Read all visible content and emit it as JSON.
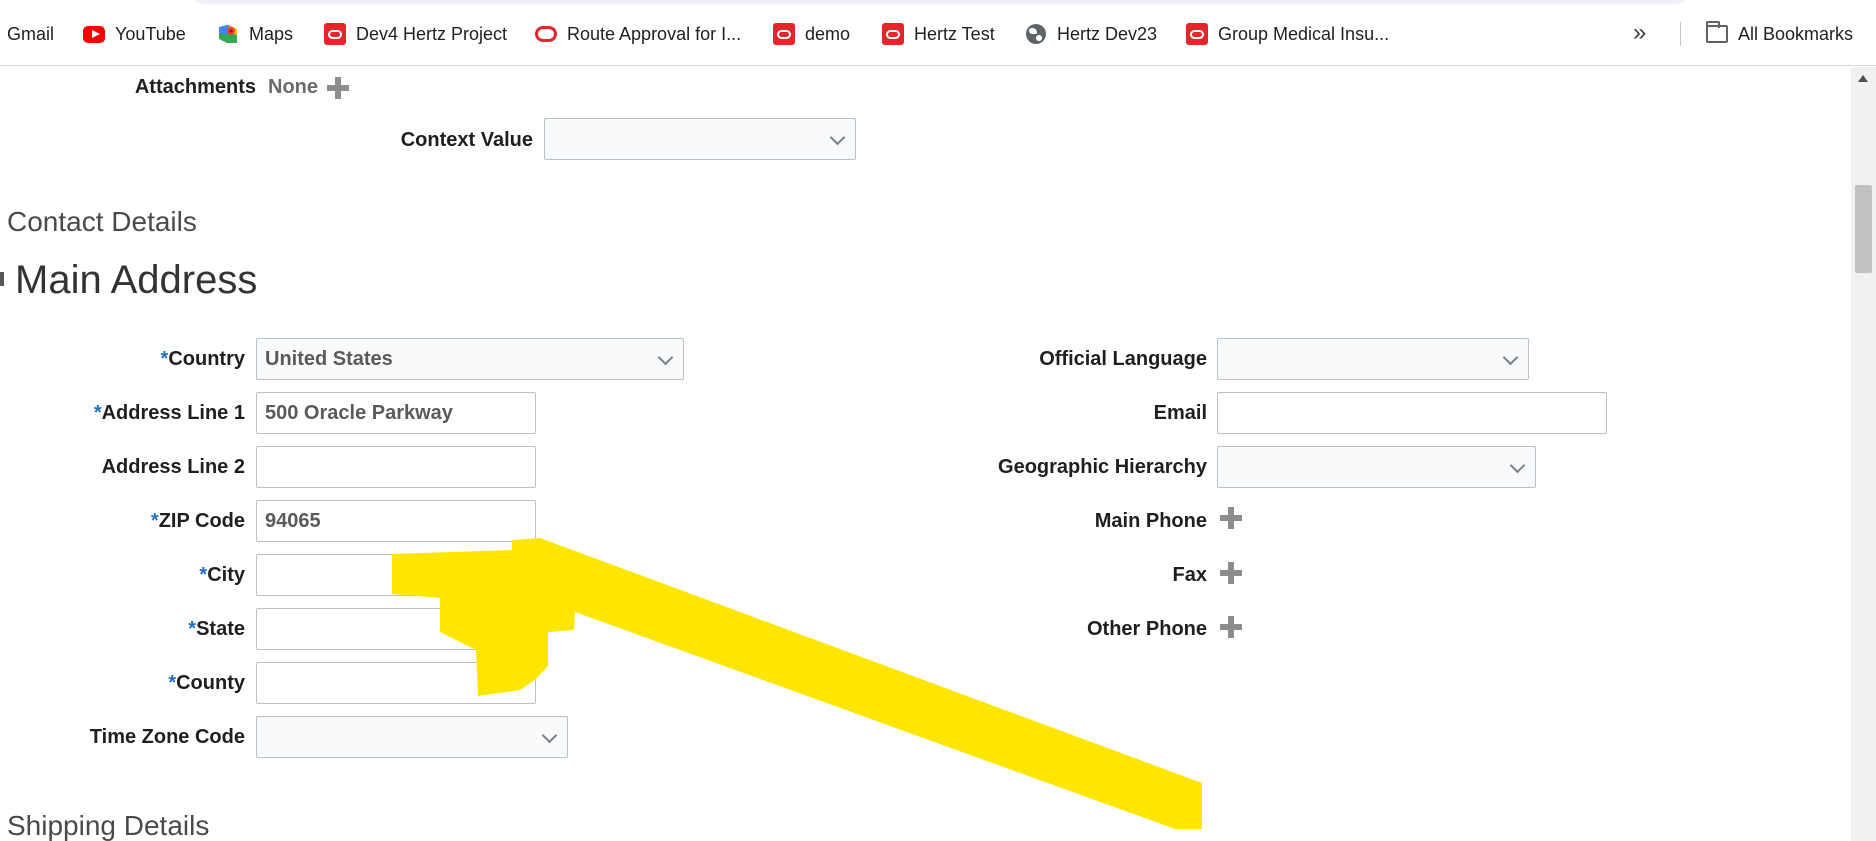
{
  "bookmarks": [
    {
      "label": "Gmail",
      "icon": "gmail-icon"
    },
    {
      "label": "YouTube",
      "icon": "youtube-icon"
    },
    {
      "label": "Maps",
      "icon": "maps-icon"
    },
    {
      "label": "Dev4 Hertz Project",
      "icon": "oracle-icon"
    },
    {
      "label": "Route Approval for I...",
      "icon": "oracle-outline-icon"
    },
    {
      "label": "demo",
      "icon": "oracle-icon"
    },
    {
      "label": "Hertz Test",
      "icon": "oracle-icon"
    },
    {
      "label": "Hertz Dev23",
      "icon": "globe-icon"
    },
    {
      "label": "Group Medical Insu...",
      "icon": "oracle-icon"
    }
  ],
  "more_bookmarks_glyph": "»",
  "all_bookmarks_label": "All Bookmarks",
  "attachments": {
    "label": "Attachments",
    "value": "None"
  },
  "context_value": {
    "label": "Context Value",
    "value": ""
  },
  "sections": {
    "contact_details": "Contact Details",
    "main_address": "Main Address",
    "shipping_details": "Shipping Details"
  },
  "required_marker": "*",
  "left_fields": {
    "country": {
      "label": "Country",
      "value": "United States",
      "required": true
    },
    "address_line_1": {
      "label": "Address Line 1",
      "value": "500 Oracle Parkway",
      "required": true
    },
    "address_line_2": {
      "label": "Address Line 2",
      "value": "",
      "required": false
    },
    "zip_code": {
      "label": "ZIP Code",
      "value": "94065",
      "required": true
    },
    "city": {
      "label": "City",
      "value": "",
      "required": true
    },
    "state": {
      "label": "State",
      "value": "",
      "required": true
    },
    "county": {
      "label": "County",
      "value": "",
      "required": true
    },
    "time_zone_code": {
      "label": "Time Zone Code",
      "value": "",
      "required": false
    }
  },
  "right_fields": {
    "official_language": {
      "label": "Official Language",
      "value": ""
    },
    "email": {
      "label": "Email",
      "value": ""
    },
    "geographic_hierarchy": {
      "label": "Geographic Hierarchy",
      "value": ""
    },
    "main_phone": {
      "label": "Main Phone"
    },
    "fax": {
      "label": "Fax"
    },
    "other_phone": {
      "label": "Other Phone"
    }
  },
  "colors": {
    "required_star": "#1f6fc6",
    "highlight": "#ffe600",
    "oracle_red": "#e2262a"
  }
}
